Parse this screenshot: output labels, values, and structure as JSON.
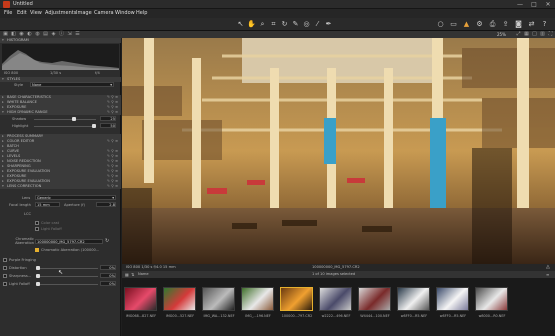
{
  "window": {
    "title": "Untitled",
    "minimize": "—",
    "maximize": "□",
    "close": "✕"
  },
  "menu": [
    "File",
    "Edit",
    "View",
    "Adjustments",
    "Image",
    "Camera",
    "Window",
    "Help"
  ],
  "toolbar": {
    "zoom": "25%"
  },
  "histogram": {
    "label": "HISTOGRAM",
    "iso": "ISO 800",
    "shutter": "1/30 s",
    "aperture": "f/4"
  },
  "styles": {
    "header": "STYLES",
    "style_label": "Style",
    "style_value": "None"
  },
  "panels": [
    "BASE CHARACTERISTICS",
    "WHITE BALANCE",
    "EXPOSURE",
    "HIGH DYNAMIC RANGE"
  ],
  "hdr": {
    "shadow_label": "Shadow",
    "shadow_value": "25",
    "highlight_label": "Highlight",
    "highlight_value": "50"
  },
  "panels2": [
    "PROCESS SUMMARY",
    "COLOR EDITOR",
    "BATCH",
    "CURVE",
    "LEVELS",
    "NOISE REDUCTION",
    "SHARPENING",
    "EXPOSURE EVALUATION",
    "EXPOSURE",
    "EXPOSURE EVALUATION",
    "LENS CORRECTION"
  ],
  "lens": {
    "lens_label": "Lens",
    "lens_value": "Generic",
    "focal_label": "Focal length",
    "focal_value": "15 mm",
    "aperture_label": "Aperture (f)",
    "aperture_value": "2.8",
    "lcc_label": "LCC",
    "color_cast": "Color cast",
    "light_falloff": "Light Falloff",
    "ca_label": "Chromatic Aberration",
    "ca_value": "100000000_MG_5797.CR2",
    "ca_check": "Chromatic Aberration (100000..."
  },
  "bottom_options": [
    {
      "label": "Purple Fringing",
      "value": ""
    },
    {
      "label": "Distortion",
      "value": "0%"
    },
    {
      "label": "Sharpness...",
      "value": "0%"
    },
    {
      "label": "Light Falloff",
      "value": "0%"
    }
  ],
  "viewer_status": {
    "left": "ISO 800   1/30 s   f/4.0   15 mm",
    "center": "100000000_MG_5797.CR2"
  },
  "browser": {
    "sort_label": "Name",
    "count": "1 of 10 images selected"
  },
  "thumbnails": [
    {
      "name": "IMG068...827.NEF",
      "colors": [
        "#7a1120",
        "#e64a6a",
        "#2a2a2a"
      ]
    },
    {
      "name": "IMG00...527.NEF",
      "colors": [
        "#2f7a2f",
        "#d53a3a",
        "#e8e8e8"
      ]
    },
    {
      "name": "IMG_WA...132.NEF",
      "colors": [
        "#555",
        "#bbb",
        "#222"
      ]
    },
    {
      "name": "IMG_...196.NEF",
      "colors": [
        "#3f6f2a",
        "#e8e8e8",
        "#8a5a3a"
      ]
    },
    {
      "name": "100000...797.CR2",
      "colors": [
        "#6a3a10",
        "#f0a030",
        "#2a1a0a"
      ]
    },
    {
      "name": "w2222...496.NEF",
      "colors": [
        "#dddddd",
        "#4a4a6a",
        "#c8c8c8"
      ]
    },
    {
      "name": "W4444...100.NEF",
      "colors": [
        "#d8d8d8",
        "#7a2a2a",
        "#aaaaaa"
      ]
    },
    {
      "name": "w8FF0...R5.NEF",
      "colors": [
        "#2a3a4a",
        "#f0f0f0",
        "#555"
      ]
    },
    {
      "name": "w8FF0...R5.NEF",
      "colors": [
        "#3a4a6a",
        "#f5f5f5",
        "#7a7a9a"
      ]
    },
    {
      "name": "w8000...R0.NEF",
      "colors": [
        "#4a4a4a",
        "#e8e8e8",
        "#8a3a3a"
      ]
    }
  ],
  "colors": {
    "accent": "#e6b02e",
    "panel": "#2d2d2d",
    "header": "#3a3a3a"
  }
}
